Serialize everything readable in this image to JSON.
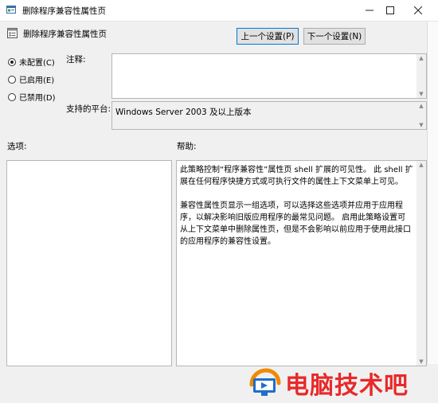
{
  "window": {
    "title": "删除程序兼容性属性页",
    "controls": [
      "minimize-icon",
      "maximize-icon",
      "close-icon"
    ]
  },
  "header": {
    "setting_name": "删除程序兼容性属性页",
    "prev_button": "上一个设置(P)",
    "next_button": "下一个设置(N)"
  },
  "state_options": [
    {
      "label": "未配置(C)",
      "selected": true
    },
    {
      "label": "已启用(E)",
      "selected": false
    },
    {
      "label": "已禁用(D)",
      "selected": false
    }
  ],
  "comment": {
    "label": "注释:",
    "value": ""
  },
  "platform": {
    "label": "支持的平台:",
    "value": "Windows Server 2003 及以上版本"
  },
  "options": {
    "label": "选项:"
  },
  "help": {
    "label": "帮助:",
    "text": "此策略控制“程序兼容性”属性页 shell 扩展的可见性。 此 shell 扩展在任何程序快捷方式或可执行文件的属性上下文菜单上可见。\n\n兼容性属性页显示一组选项，可以选择这些选项并应用于应用程序，以解决影响旧版应用程序的最常见问题。 启用此策略设置可从上下文菜单中删除属性页，但是不会影响以前应用于使用此接口的应用程序的兼容性设置。"
  },
  "watermark": {
    "text": "电脑技术吧",
    "logo_icon": "computer-logo-icon",
    "color": "#e8292a"
  }
}
